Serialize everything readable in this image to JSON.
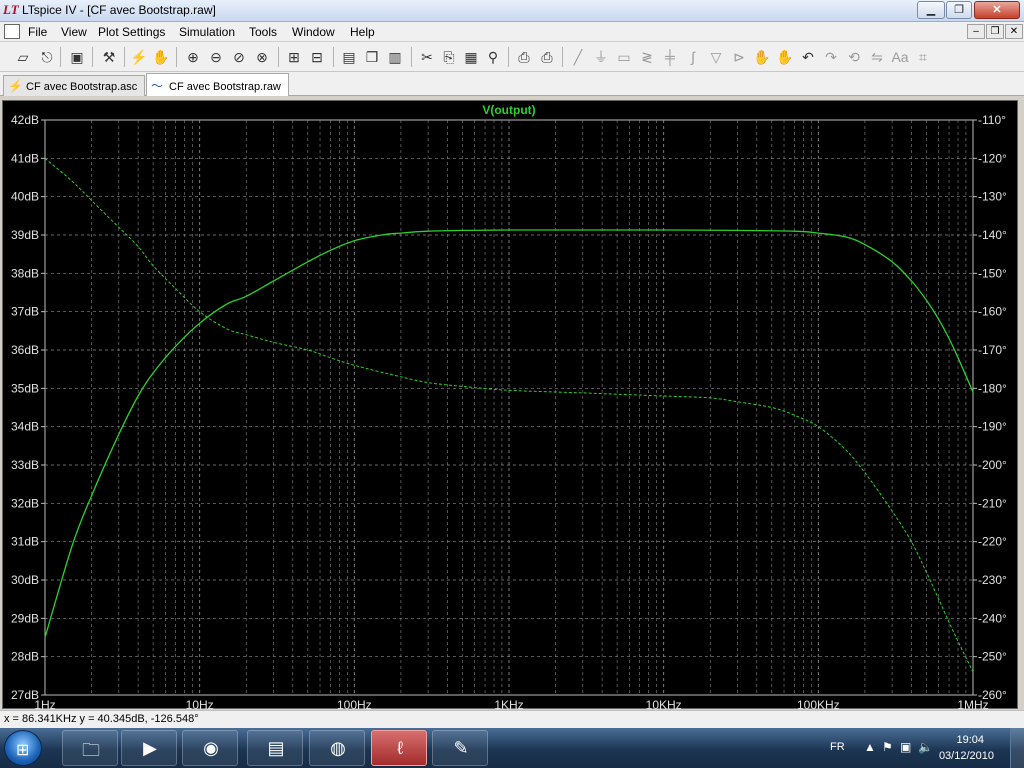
{
  "window": {
    "title": "LTspice IV - [CF avec Bootstrap.raw]",
    "minimize": "▁",
    "restore": "❐",
    "close": "✕"
  },
  "menubar": {
    "items": [
      "File",
      "View",
      "Plot Settings",
      "Simulation",
      "Tools",
      "Window",
      "Help"
    ],
    "mdi_min": "–",
    "mdi_restore": "❐",
    "mdi_close": "✕"
  },
  "toolbar": {
    "icons": [
      "open-icon",
      "save-icon",
      "control-panel-icon",
      "run-icon",
      "halt-icon",
      "zoom-in-icon",
      "zoom-out-icon",
      "zoom-back-icon",
      "zoom-extents-icon",
      "autorange-icon",
      "tile-horizontal-icon",
      "cascade-icon",
      "tile-vertical-icon",
      "cut-icon",
      "copy-icon",
      "paste-icon",
      "find-icon",
      "print-setup-icon",
      "print-icon",
      "wire-icon",
      "ground-icon",
      "label-icon",
      "resistor-icon",
      "capacitor-icon",
      "inductor-icon",
      "diode-icon",
      "component-icon",
      "move-icon",
      "drag-icon",
      "undo-icon",
      "redo-icon",
      "rotate-icon",
      "mirror-icon",
      "text-icon",
      "spice-directive-icon"
    ]
  },
  "tabs": [
    {
      "label": "CF avec Bootstrap.asc",
      "icon": "schematic-icon",
      "active": false
    },
    {
      "label": "CF avec Bootstrap.raw",
      "icon": "waveform-icon",
      "active": true
    }
  ],
  "plot": {
    "trace_label": "V(output)",
    "trace_color": "#2bd12b",
    "grid_color": "#8a8a8a",
    "background": "#000000"
  },
  "chart_data": {
    "type": "line",
    "title": "V(output)",
    "x_scale": "log",
    "xlim": [
      1,
      1000000
    ],
    "x_ticks": [
      "1Hz",
      "10Hz",
      "100Hz",
      "1KHz",
      "10KHz",
      "100KHz",
      "1MHz"
    ],
    "ylim_left": [
      27,
      42
    ],
    "y_ticks_left": [
      "42dB",
      "41dB",
      "40dB",
      "39dB",
      "38dB",
      "37dB",
      "36dB",
      "35dB",
      "34dB",
      "33dB",
      "32dB",
      "31dB",
      "30dB",
      "29dB",
      "28dB",
      "27dB"
    ],
    "ylim_right": [
      -260,
      -110
    ],
    "y_ticks_right": [
      "-110°",
      "-120°",
      "-130°",
      "-140°",
      "-150°",
      "-160°",
      "-170°",
      "-180°",
      "-190°",
      "-200°",
      "-210°",
      "-220°",
      "-230°",
      "-240°",
      "-250°",
      "-260°"
    ],
    "grid": true,
    "series": [
      {
        "style": "solid",
        "axis": "left",
        "x": [
          1,
          1.5,
          2,
          3,
          4,
          5,
          7,
          10,
          15,
          20,
          30,
          50,
          70,
          100,
          150,
          200,
          300,
          500,
          1000,
          3000,
          10000,
          30000,
          70000,
          100000,
          150000,
          200000,
          300000,
          400000,
          500000,
          600000,
          700000,
          800000,
          1000000
        ],
        "y": [
          28.5,
          30.9,
          32.2,
          33.8,
          34.8,
          35.4,
          36.1,
          36.7,
          37.2,
          37.4,
          37.8,
          38.3,
          38.6,
          38.85,
          39.0,
          39.05,
          39.1,
          39.12,
          39.13,
          39.13,
          39.13,
          39.12,
          39.1,
          39.05,
          38.95,
          38.75,
          38.3,
          37.8,
          37.3,
          36.8,
          36.3,
          35.8,
          34.9
        ]
      },
      {
        "style": "dashed",
        "axis": "right",
        "x": [
          1,
          1.5,
          2,
          3,
          4,
          5,
          7,
          10,
          15,
          20,
          30,
          50,
          70,
          100,
          200,
          300,
          500,
          1000,
          3000,
          10000,
          20000,
          30000,
          50000,
          70000,
          100000,
          150000,
          200000,
          300000,
          400000,
          500000,
          600000,
          700000,
          800000,
          1000000
        ],
        "y": [
          -120,
          -126,
          -131,
          -138,
          -143,
          -148,
          -154,
          -160,
          -164.5,
          -166,
          -168,
          -170,
          -172,
          -174,
          -177,
          -178.5,
          -179.5,
          -180.5,
          -181.2,
          -182,
          -182.5,
          -183.5,
          -185,
          -187,
          -190,
          -196,
          -202,
          -212,
          -220,
          -228,
          -235,
          -241,
          -246,
          -254
        ]
      }
    ]
  },
  "status": {
    "readout": "x = 86.341KHz    y = 40.345dB, -126.548°"
  },
  "taskbar": {
    "start_glyph": "⊞",
    "tasks": [
      {
        "name": "explorer-task",
        "glyph": "🗀",
        "active": false
      },
      {
        "name": "media-player-task",
        "glyph": "▶",
        "active": false
      },
      {
        "name": "app-red-task",
        "glyph": "◉",
        "active": false
      },
      {
        "name": "folder-task",
        "glyph": "▤",
        "active": false
      },
      {
        "name": "firefox-task",
        "glyph": "◍",
        "active": false
      },
      {
        "name": "ltspice-task",
        "glyph": "ℓ",
        "active": true
      },
      {
        "name": "gimp-task",
        "glyph": "✎",
        "active": false
      }
    ],
    "language": "FR",
    "time": "19:04",
    "date": "03/12/2010"
  }
}
